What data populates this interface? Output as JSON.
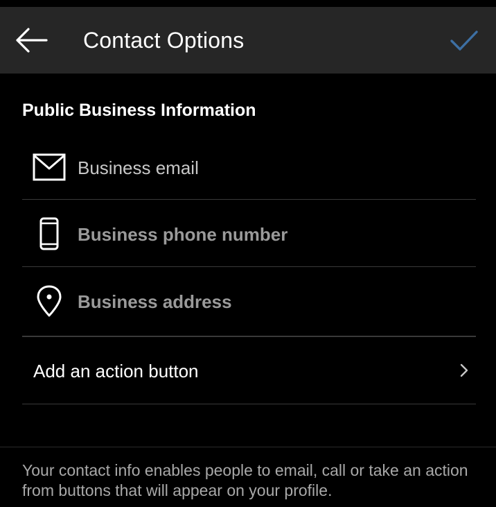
{
  "header": {
    "title": "Contact Options",
    "back_icon": "arrow-left-icon",
    "confirm_icon": "checkmark-icon",
    "confirm_color": "#3d6fa3"
  },
  "section": {
    "heading": "Public Business Information"
  },
  "fields": [
    {
      "icon": "envelope-icon",
      "value": "",
      "placeholder": "Business email"
    },
    {
      "icon": "smartphone-icon",
      "value": "",
      "placeholder": "Business phone number"
    },
    {
      "icon": "location-pin-icon",
      "value": "",
      "placeholder": "Business address"
    }
  ],
  "action_row": {
    "label": "Add an action button",
    "icon": "chevron-right-icon"
  },
  "footer": {
    "note": "Your contact info enables people to email, call or take an action from buttons that will appear on your profile."
  },
  "colors": {
    "background": "#000000",
    "header_background": "#262626",
    "divider": "#3a3a3a",
    "secondary_text": "#a8a8a8"
  }
}
